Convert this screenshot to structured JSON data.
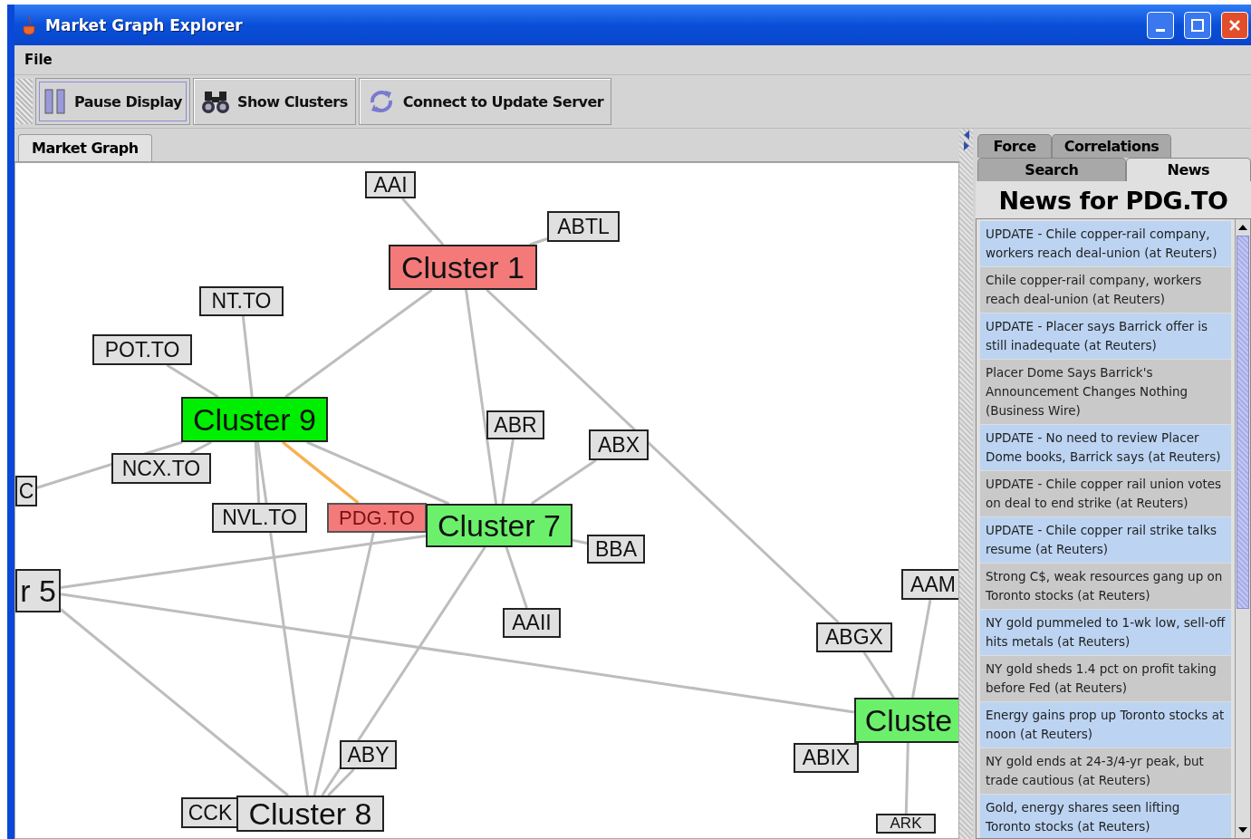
{
  "window": {
    "title": "Market Graph Explorer"
  },
  "menu": [
    "File"
  ],
  "toolbar": [
    {
      "label": "Pause Display",
      "pressed": true
    },
    {
      "label": "Show Clusters",
      "pressed": false
    },
    {
      "label": "Connect to Update Server",
      "pressed": false
    }
  ],
  "left_tabs": [
    {
      "label": "Market Graph",
      "selected": true
    }
  ],
  "graph": {
    "nodes": [
      {
        "label": "AAI",
        "kind": "stock",
        "color": "#e0e0e0",
        "selected": false
      },
      {
        "label": "ABTL",
        "kind": "stock",
        "color": "#e0e0e0",
        "selected": false
      },
      {
        "label": "Cluster 1",
        "kind": "cluster",
        "color": "#f47a7a",
        "selected": false
      },
      {
        "label": "NT.TO",
        "kind": "stock",
        "color": "#e0e0e0",
        "selected": false
      },
      {
        "label": "POT.TO",
        "kind": "stock",
        "color": "#e0e0e0",
        "selected": false
      },
      {
        "label": "Cluster 9",
        "kind": "cluster",
        "color": "#00ee00",
        "selected": false
      },
      {
        "label": "ABR",
        "kind": "stock",
        "color": "#e0e0e0",
        "selected": false
      },
      {
        "label": "ABX",
        "kind": "stock",
        "color": "#e0e0e0",
        "selected": false
      },
      {
        "label": "NCX.TO",
        "kind": "stock",
        "color": "#e0e0e0",
        "selected": false
      },
      {
        "label": "C",
        "kind": "stock",
        "color": "#e0e0e0",
        "selected": false
      },
      {
        "label": "NVL.TO",
        "kind": "stock",
        "color": "#e0e0e0",
        "selected": false
      },
      {
        "label": "PDG.TO",
        "kind": "stock",
        "color": "#f47a7a",
        "selected": true
      },
      {
        "label": "Cluster 7",
        "kind": "cluster",
        "color": "#6cf06c",
        "selected": false
      },
      {
        "label": "BBA",
        "kind": "stock",
        "color": "#e0e0e0",
        "selected": false
      },
      {
        "label": "r 5",
        "kind": "cluster",
        "color": "#e0e0e0",
        "selected": false
      },
      {
        "label": "AAM",
        "kind": "stock",
        "color": "#e0e0e0",
        "selected": false
      },
      {
        "label": "AAII",
        "kind": "stock",
        "color": "#e0e0e0",
        "selected": false
      },
      {
        "label": "ABGX",
        "kind": "stock",
        "color": "#e0e0e0",
        "selected": false
      },
      {
        "label": "Cluste",
        "kind": "cluster",
        "color": "#6cf06c",
        "selected": false
      },
      {
        "label": "ABY",
        "kind": "stock",
        "color": "#e0e0e0",
        "selected": false
      },
      {
        "label": "ABIX",
        "kind": "stock",
        "color": "#e0e0e0",
        "selected": false
      },
      {
        "label": "CCK",
        "kind": "stock",
        "color": "#e0e0e0",
        "selected": false
      },
      {
        "label": "Cluster 8",
        "kind": "cluster",
        "color": "#e0e0e0",
        "selected": false
      },
      {
        "label": "ARK",
        "kind": "stock",
        "color": "#e0e0e0",
        "selected": false
      }
    ]
  },
  "right_tabs": {
    "back_row": [
      {
        "label": "Force",
        "selected": false
      },
      {
        "label": "Correlations",
        "selected": false
      }
    ],
    "front_row": [
      {
        "label": "Search",
        "selected": false
      },
      {
        "label": "News",
        "selected": true
      }
    ]
  },
  "news": {
    "heading": "News for PDG.TO",
    "items": [
      "UPDATE - Chile copper-rail company, workers reach deal-union (at Reuters)",
      "Chile copper-rail company, workers reach deal-union (at Reuters)",
      "UPDATE - Placer says Barrick offer is still inadequate (at Reuters)",
      "Placer Dome Says Barrick's Announcement Changes Nothing (Business Wire)",
      "UPDATE - No need to review Placer Dome books, Barrick says (at Reuters)",
      "UPDATE - Chile copper rail union votes on deal to end strike (at Reuters)",
      "UPDATE - Chile copper rail strike talks resume (at Reuters)",
      "Strong C$, weak resources gang up on Toronto stocks (at Reuters)",
      "NY gold pummeled to 1-wk low, sell-off hits metals (at Reuters)",
      "NY gold sheds 1.4 pct on profit taking before Fed (at Reuters)",
      "Energy gains prop up Toronto stocks at noon (at Reuters)",
      "NY gold ends at 24-3/4-yr peak, but trade cautious (at Reuters)",
      "Gold, energy shares seen lifting Toronto stocks (at Reuters)"
    ]
  }
}
